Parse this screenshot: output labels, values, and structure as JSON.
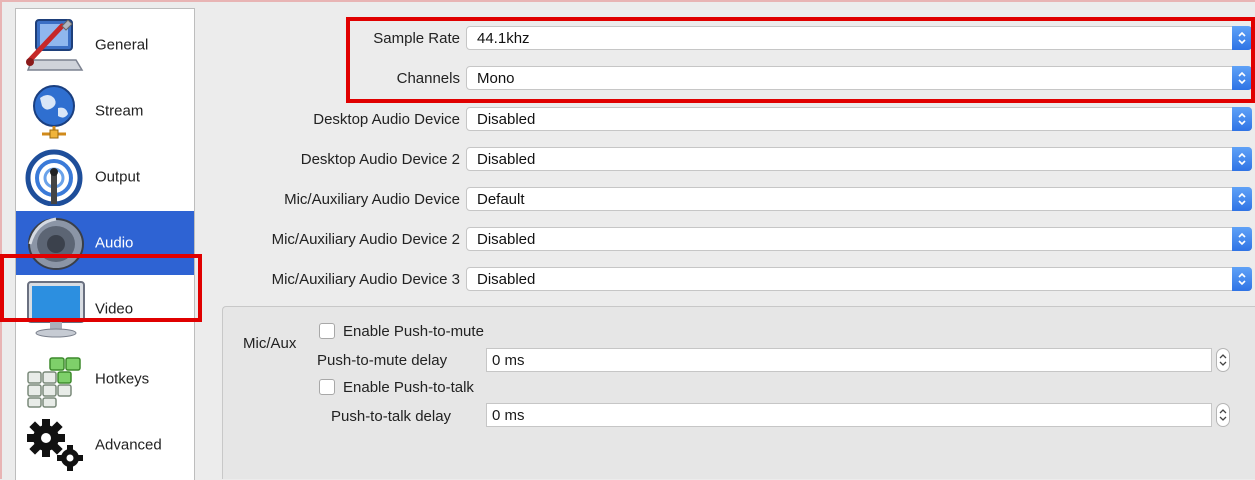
{
  "sidebar": {
    "items": [
      {
        "label": "General",
        "icon": "general-settings-icon"
      },
      {
        "label": "Stream",
        "icon": "globe-network-icon"
      },
      {
        "label": "Output",
        "icon": "broadcast-antenna-icon"
      },
      {
        "label": "Audio",
        "icon": "speaker-icon",
        "selected": true
      },
      {
        "label": "Video",
        "icon": "monitor-icon"
      },
      {
        "label": "Hotkeys",
        "icon": "keyboard-icon"
      },
      {
        "label": "Advanced",
        "icon": "gears-icon"
      }
    ]
  },
  "audio": {
    "sample_rate": {
      "label": "Sample Rate",
      "value": "44.1khz"
    },
    "channels": {
      "label": "Channels",
      "value": "Mono"
    },
    "desktop_audio_device": {
      "label": "Desktop Audio Device",
      "value": "Disabled"
    },
    "desktop_audio_device_2": {
      "label": "Desktop Audio Device 2",
      "value": "Disabled"
    },
    "mic_aux_device": {
      "label": "Mic/Auxiliary Audio Device",
      "value": "Default"
    },
    "mic_aux_device_2": {
      "label": "Mic/Auxiliary Audio Device 2",
      "value": "Disabled"
    },
    "mic_aux_device_3": {
      "label": "Mic/Auxiliary Audio Device 3",
      "value": "Disabled"
    }
  },
  "mic_aux_group": {
    "title": "Mic/Aux",
    "push_to_mute_checkbox": "Enable Push-to-mute",
    "push_to_mute_delay_label": "Push-to-mute delay",
    "push_to_mute_delay_value": "0 ms",
    "push_to_talk_checkbox": "Enable Push-to-talk",
    "push_to_talk_delay_label": "Push-to-talk delay",
    "push_to_talk_delay_value": "0 ms"
  },
  "colors": {
    "selection": "#2e63d3",
    "highlight_box": "#e00000",
    "stepper_blue": "#2f73e5"
  }
}
